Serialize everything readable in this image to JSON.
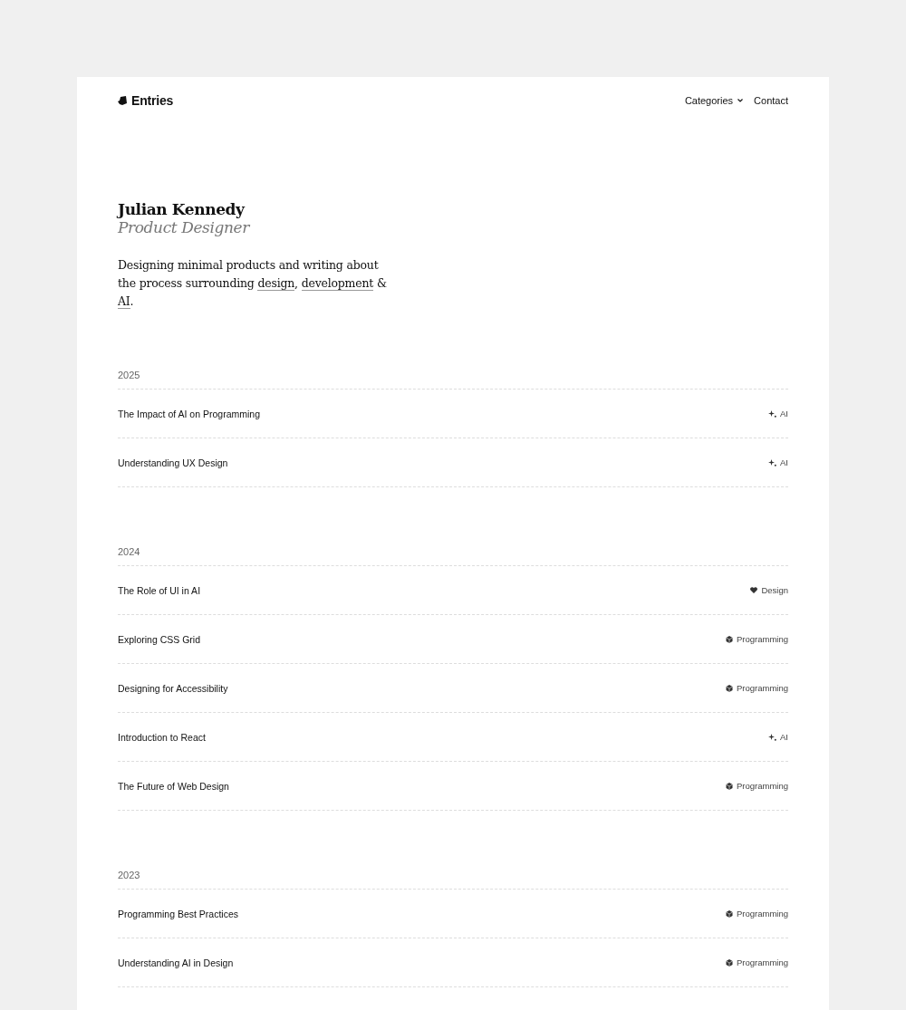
{
  "header": {
    "logo": "Entries",
    "nav": [
      {
        "label": "Categories",
        "kind": "dropdown"
      },
      {
        "label": "Contact",
        "kind": "link"
      }
    ]
  },
  "hero": {
    "name": "Julian Kennedy",
    "role": "Product Designer",
    "intro": [
      {
        "kind": "text",
        "text": "Designing minimal products and writing about the process surrounding "
      },
      {
        "kind": "link",
        "text": "design"
      },
      {
        "kind": "text",
        "text": ", "
      },
      {
        "kind": "link",
        "text": "development"
      },
      {
        "kind": "text",
        "text": " & "
      },
      {
        "kind": "link",
        "text": "AI"
      },
      {
        "kind": "text",
        "text": "."
      }
    ]
  },
  "years": [
    {
      "year": "2025",
      "entries": [
        {
          "title": "The Impact of AI on Programming",
          "category": "AI",
          "kind": "ai"
        },
        {
          "title": "Understanding UX Design",
          "category": "AI",
          "kind": "ai"
        }
      ]
    },
    {
      "year": "2024",
      "entries": [
        {
          "title": "The Role of UI in AI",
          "category": "Design",
          "kind": "design"
        },
        {
          "title": "Exploring CSS Grid",
          "category": "Programming",
          "kind": "programming"
        },
        {
          "title": "Designing for Accessibility",
          "category": "Programming",
          "kind": "programming"
        },
        {
          "title": "Introduction to React",
          "category": "AI",
          "kind": "ai"
        },
        {
          "title": "The Future of Web Design",
          "category": "Programming",
          "kind": "programming"
        }
      ]
    },
    {
      "year": "2023",
      "entries": [
        {
          "title": "Programming Best Practices",
          "category": "Programming",
          "kind": "programming"
        },
        {
          "title": "Understanding AI in Design",
          "category": "Programming",
          "kind": "programming"
        }
      ]
    }
  ]
}
